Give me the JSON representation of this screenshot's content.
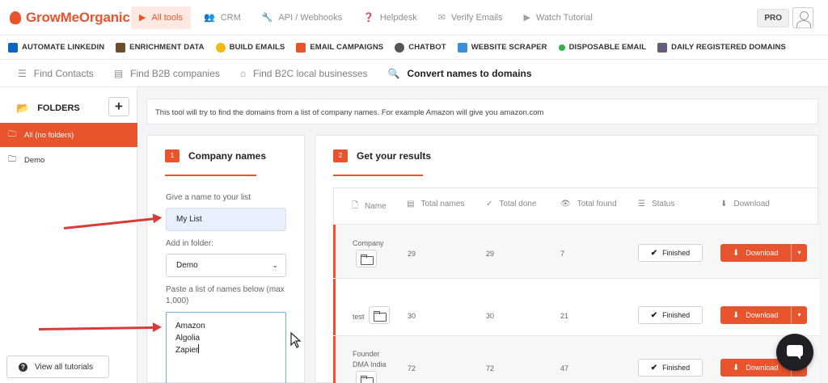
{
  "app": {
    "logo_text": "GrowMeOrganic"
  },
  "topnav": {
    "items": [
      {
        "label": "All tools",
        "icon": "play-icon",
        "active": true
      },
      {
        "label": "CRM",
        "icon": "users-icon"
      },
      {
        "label": "API / Webhooks",
        "icon": "wrench-icon"
      },
      {
        "label": "Helpdesk",
        "icon": "question-circle-icon"
      },
      {
        "label": "Verify Emails",
        "icon": "envelope-open-icon"
      },
      {
        "label": "Watch Tutorial",
        "icon": "play-icon"
      }
    ],
    "plan_badge": "PRO"
  },
  "tools": [
    {
      "label": "AUTOMATE LINKEDIN",
      "color": "#0a66c2"
    },
    {
      "label": "ENRICHMENT DATA",
      "color": "#6b4f2c"
    },
    {
      "label": "BUILD EMAILS",
      "color": "#f2b90f"
    },
    {
      "label": "EMAIL CAMPAIGNS",
      "color": "#e8542e"
    },
    {
      "label": "CHATBOT",
      "color": "#555555"
    },
    {
      "label": "WEBSITE SCRAPER",
      "color": "#3a8fd6"
    },
    {
      "label": "DISPOSABLE EMAIL",
      "color": "#2fb344"
    },
    {
      "label": "DAILY REGISTERED DOMAINS",
      "color": "#6a5a7a"
    }
  ],
  "subtabs": [
    {
      "label": "Find Contacts",
      "icon": "user-list-icon"
    },
    {
      "label": "Find B2B companies",
      "icon": "building-icon"
    },
    {
      "label": "Find B2C local businesses",
      "icon": "store-icon"
    },
    {
      "label": "Convert names to domains",
      "icon": "search-icon",
      "active": true
    }
  ],
  "sidebar": {
    "title": "FOLDERS",
    "add_label": "+",
    "folders": [
      {
        "label": "All (no folders)",
        "active": true
      },
      {
        "label": "Demo"
      }
    ],
    "tutorials_label": "View all tutorials"
  },
  "info_text": "This tool will try to find the domains from a list of company names. For example Amazon will give you amazon.com",
  "step1": {
    "number": "1",
    "title": "Company names",
    "list_name_label": "Give a name to your list",
    "list_name_value": "My List",
    "folder_label": "Add in folder:",
    "folder_value": "Demo",
    "names_label": "Paste a list of names below (max 1,000)",
    "names": [
      "Amazon",
      "Algolia",
      "Zapier"
    ]
  },
  "step2": {
    "number": "2",
    "title": "Get your results",
    "columns": [
      {
        "label": "Name",
        "icon": "file-icon"
      },
      {
        "label": "Total names",
        "icon": "list-file-icon"
      },
      {
        "label": "Total done",
        "icon": "check-icon"
      },
      {
        "label": "Total found",
        "icon": "eye-icon"
      },
      {
        "label": "Status",
        "icon": "server-icon"
      },
      {
        "label": "Download",
        "icon": "download-icon"
      }
    ],
    "rows": [
      {
        "name_lines": [
          "Company"
        ],
        "total_names": "29",
        "total_done": "29",
        "total_found": "7",
        "status": "Finished",
        "download": "Download"
      },
      {
        "name_lines": [
          "test"
        ],
        "total_names": "30",
        "total_done": "30",
        "total_found": "21",
        "status": "Finished",
        "download": "Download"
      },
      {
        "name_lines": [
          "Founder",
          "DMA India"
        ],
        "total_names": "72",
        "total_done": "72",
        "total_found": "47",
        "status": "Finished",
        "download": "Download"
      }
    ]
  },
  "colors": {
    "accent": "#e8542e",
    "annotation_arrow": "#d93a3a"
  }
}
